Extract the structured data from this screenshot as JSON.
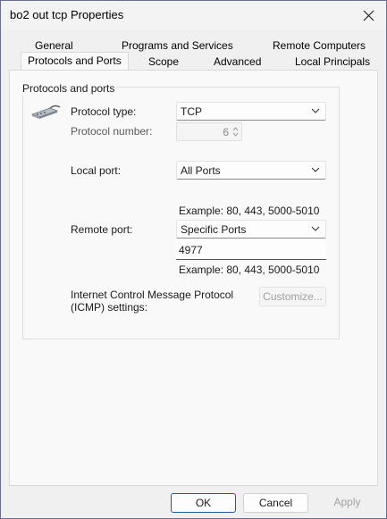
{
  "window": {
    "title": "bo2 out tcp Properties"
  },
  "tabs_row1": [
    "General",
    "Programs and Services",
    "Remote Computers"
  ],
  "tabs_row2": [
    "Protocols and Ports",
    "Scope",
    "Advanced",
    "Local Principals"
  ],
  "selected_tab": "Protocols and Ports",
  "group": {
    "label": "Protocols and ports"
  },
  "protocol_type": {
    "label": "Protocol type:",
    "value": "TCP"
  },
  "protocol_number": {
    "label": "Protocol number:",
    "value": "6"
  },
  "local_port": {
    "label": "Local port:",
    "value": "All Ports",
    "example": "Example: 80, 443, 5000-5010"
  },
  "remote_port": {
    "label": "Remote port:",
    "value": "Specific Ports",
    "port_value": "4977",
    "example": "Example: 80, 443, 5000-5010"
  },
  "icmp": {
    "label_line1": "Internet Control Message Protocol",
    "label_line2": "(ICMP) settings:",
    "button": "Customize..."
  },
  "buttons": {
    "ok": "OK",
    "cancel": "Cancel",
    "apply": "Apply"
  }
}
